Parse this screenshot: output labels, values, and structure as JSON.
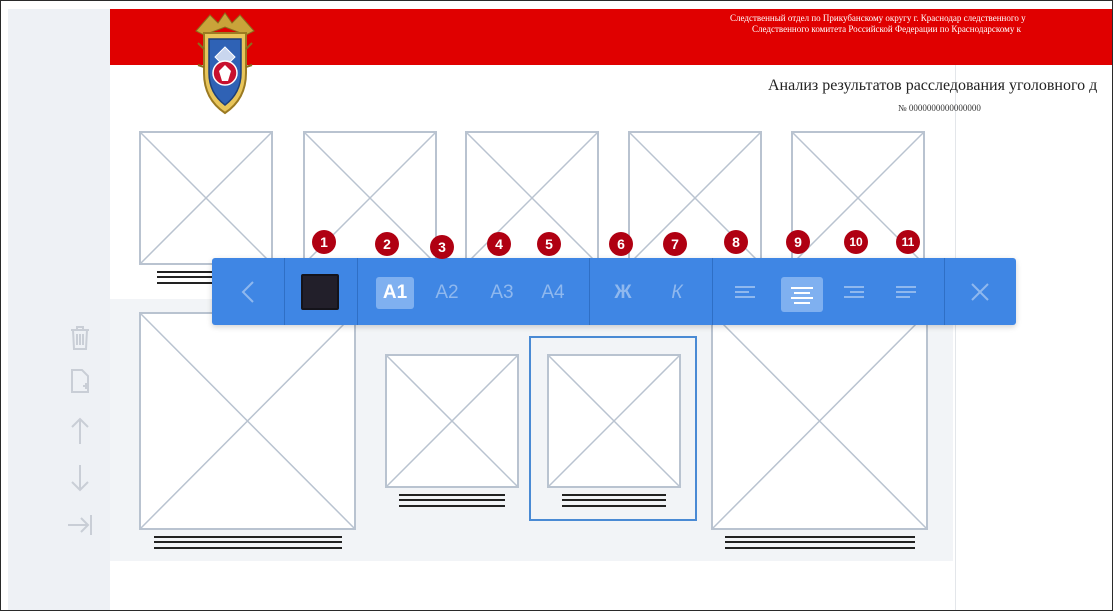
{
  "header": {
    "org_line1": "Следственный отдел по Прикубанскому округу г. Краснодар следственного у",
    "org_line2": "Следственного комитета Российской Федерации по Краснодарскому к"
  },
  "document": {
    "title": "Анализ результатов расследования уголовного д",
    "number": "№ 0000000000000000"
  },
  "toolbar": {
    "back_icon": "chevron-left-icon",
    "font_sizes": [
      {
        "label": "A1",
        "active": true
      },
      {
        "label": "A2",
        "active": false
      },
      {
        "label": "A3",
        "active": false
      },
      {
        "label": "A4",
        "active": false
      }
    ],
    "bold_label": "Ж",
    "italic_label": "К",
    "alignment_icons": [
      "align-left-icon",
      "align-center-icon",
      "align-right-icon",
      "align-justify-icon"
    ],
    "active_alignment": "align-center-icon",
    "close_icon": "close-icon",
    "swatch_color": "#221f2a"
  },
  "callouts": [
    "1",
    "2",
    "3",
    "4",
    "5",
    "6",
    "7",
    "8",
    "9",
    "10",
    "11"
  ],
  "rail_icons": [
    "trash-icon",
    "add-page-icon",
    "arrow-up-icon",
    "arrow-down-icon",
    "move-to-end-icon"
  ],
  "colors": {
    "header_red": "#e00000",
    "toolbar_blue": "#3f86e4",
    "badge_red": "#b00012",
    "selection_blue": "#4a8ad4"
  }
}
